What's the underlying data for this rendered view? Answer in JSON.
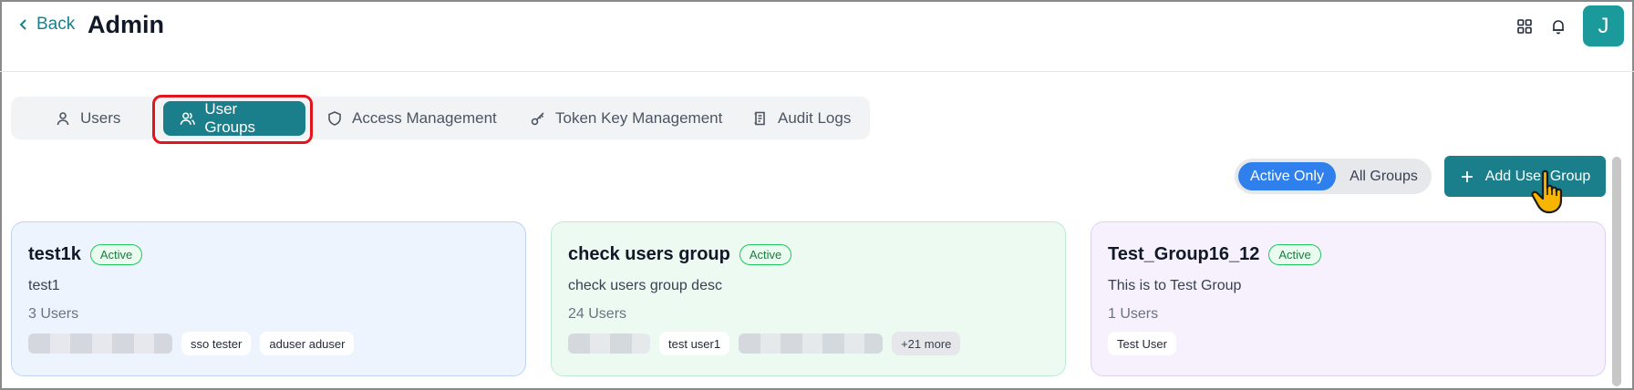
{
  "header": {
    "back_label": "Back",
    "title": "Admin",
    "icons": [
      "apps-grid-icon",
      "bell-icon"
    ],
    "avatar_initial": "J"
  },
  "tabs": [
    {
      "label": "Users",
      "icon": "user-icon",
      "active": false
    },
    {
      "label": "User Groups",
      "icon": "users-icon",
      "active": true
    },
    {
      "label": "Access Management",
      "icon": "shield-icon",
      "active": false
    },
    {
      "label": "Token Key Management",
      "icon": "key-icon",
      "active": false
    },
    {
      "label": "Audit Logs",
      "icon": "log-icon",
      "active": false
    }
  ],
  "toolbar": {
    "filter_active_label": "Active Only",
    "filter_all_label": "All Groups",
    "selected_filter": "Active Only",
    "add_button_label": "Add User Group"
  },
  "colors": {
    "accent": "#1a7f8a",
    "toggle_on": "#2f80ed",
    "highlight": "#e3141b",
    "active_badge": "#22c55e"
  },
  "groups": [
    {
      "name": "test1k",
      "status": "Active",
      "description": "test1",
      "user_count": "3 Users",
      "members": [
        "sso tester",
        "aduser aduser"
      ],
      "more": ""
    },
    {
      "name": "check users group",
      "status": "Active",
      "description": "check users group desc",
      "user_count": "24 Users",
      "members": [
        "test user1"
      ],
      "more": "+21 more"
    },
    {
      "name": "Test_Group16_12",
      "status": "Active",
      "description": "This is to Test Group",
      "user_count": "1 Users",
      "members": [
        "Test User"
      ],
      "more": ""
    }
  ]
}
